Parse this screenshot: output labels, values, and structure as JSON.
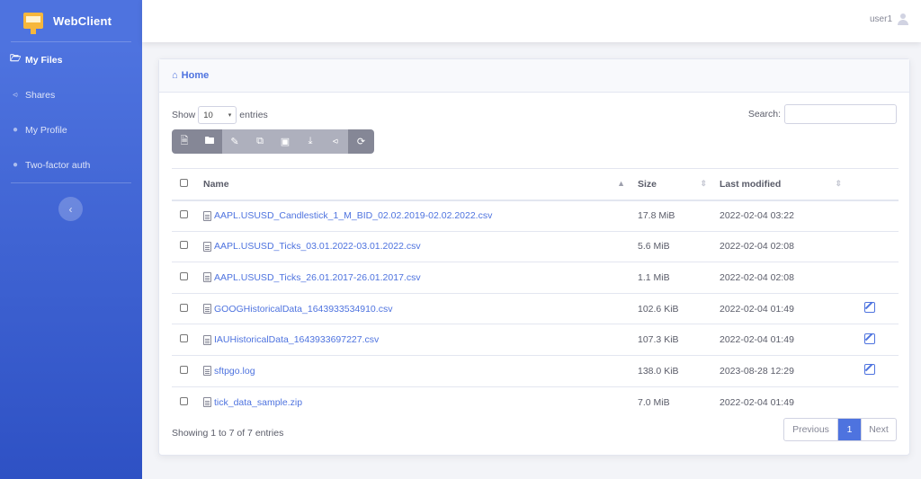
{
  "app": {
    "name": "WebClient",
    "logo_icon": "sftpgo-logo-icon"
  },
  "sidebar": {
    "items": [
      {
        "label": "My Files",
        "icon": "folder-open-icon",
        "active": true
      },
      {
        "label": "Shares",
        "icon": "share-icon",
        "active": false
      },
      {
        "label": "My Profile",
        "icon": "user-icon",
        "active": false
      },
      {
        "label": "Two-factor auth",
        "icon": "users-icon",
        "active": false
      }
    ],
    "toggle_icon": "chevron-left-icon"
  },
  "topbar": {
    "username": "user1",
    "user_icon": "user-icon"
  },
  "card": {
    "title": "Home",
    "home_icon": "home-icon"
  },
  "controls": {
    "show_label": "Show",
    "page_size": "10",
    "entries_label": "entries",
    "search_label": "Search:",
    "search_value": ""
  },
  "toolbar": {
    "buttons": [
      {
        "name": "new-file-button",
        "icon": "file-plus-icon",
        "enabled": true
      },
      {
        "name": "new-folder-button",
        "icon": "folder-plus-icon",
        "enabled": true
      },
      {
        "name": "rename-button",
        "icon": "pencil-icon",
        "enabled": false
      },
      {
        "name": "copy-button",
        "icon": "copy-icon",
        "enabled": false
      },
      {
        "name": "delete-button",
        "icon": "trash-icon",
        "enabled": false
      },
      {
        "name": "download-button",
        "icon": "download-icon",
        "enabled": false
      },
      {
        "name": "share-button",
        "icon": "share-icon",
        "enabled": false
      },
      {
        "name": "refresh-button",
        "icon": "refresh-icon",
        "enabled": true
      }
    ]
  },
  "table": {
    "headers": {
      "name": "Name",
      "size": "Size",
      "modified": "Last modified"
    },
    "rows": [
      {
        "name": "AAPL.USUSD_Candlestick_1_M_BID_02.02.2019-02.02.2022.csv",
        "size": "17.8 MiB",
        "modified": "2022-02-04 03:22",
        "editable": false
      },
      {
        "name": "AAPL.USUSD_Ticks_03.01.2022-03.01.2022.csv",
        "size": "5.6 MiB",
        "modified": "2022-02-04 02:08",
        "editable": false
      },
      {
        "name": "AAPL.USUSD_Ticks_26.01.2017-26.01.2017.csv",
        "size": "1.1 MiB",
        "modified": "2022-02-04 02:08",
        "editable": false
      },
      {
        "name": "GOOGHistoricalData_1643933534910.csv",
        "size": "102.6 KiB",
        "modified": "2022-02-04 01:49",
        "editable": true
      },
      {
        "name": "IAUHistoricalData_1643933697227.csv",
        "size": "107.3 KiB",
        "modified": "2022-02-04 01:49",
        "editable": true
      },
      {
        "name": "sftpgo.log",
        "size": "138.0 KiB",
        "modified": "2023-08-28 12:29",
        "editable": true
      },
      {
        "name": "tick_data_sample.zip",
        "size": "7.0 MiB",
        "modified": "2022-02-04 01:49",
        "editable": false
      }
    ]
  },
  "footer": {
    "info": "Showing 1 to 7 of 7 entries",
    "previous": "Previous",
    "current_page": "1",
    "next": "Next"
  }
}
